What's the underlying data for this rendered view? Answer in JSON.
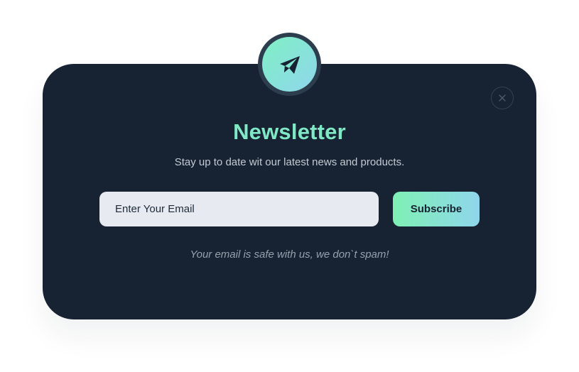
{
  "newsletter": {
    "icon": "paper-plane-icon",
    "close_icon": "close-icon",
    "title": "Newsletter",
    "subtitle": "Stay up to date wit our latest news and products.",
    "email_placeholder": "Enter Your Email",
    "email_value": "",
    "subscribe_label": "Subscribe",
    "note": "Your email is safe with us, we don`t spam!"
  },
  "colors": {
    "modal_background": "#172232",
    "title_accent": "#7fe9c6",
    "gradient_start": "#7ff0b4",
    "gradient_end": "#8fd6ec",
    "input_background": "#e7eaf0"
  }
}
